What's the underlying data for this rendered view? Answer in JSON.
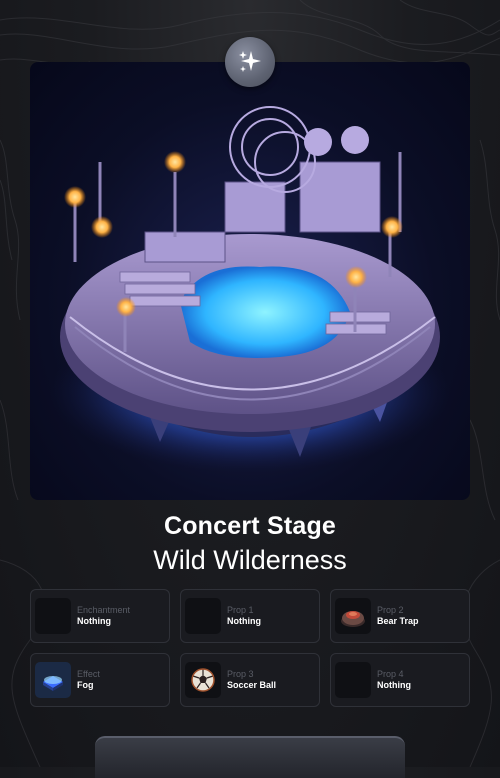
{
  "item": {
    "name": "Concert Stage",
    "category": "Wild Wilderness"
  },
  "slots": [
    {
      "label": "Enchantment",
      "value": "Nothing",
      "icon": "empty-slot-icon"
    },
    {
      "label": "Prop 1",
      "value": "Nothing",
      "icon": "empty-slot-icon"
    },
    {
      "label": "Prop 2",
      "value": "Bear Trap",
      "icon": "bear-trap-icon"
    },
    {
      "label": "Effect",
      "value": "Fog",
      "icon": "fog-icon"
    },
    {
      "label": "Prop 3",
      "value": "Soccer Ball",
      "icon": "soccer-ball-icon"
    },
    {
      "label": "Prop 4",
      "value": "Nothing",
      "icon": "empty-slot-icon"
    }
  ],
  "colors": {
    "background": "#18191d",
    "slot_border": "#2f3138",
    "glow": "#4aa8ff",
    "lamp": "#ffb347"
  }
}
